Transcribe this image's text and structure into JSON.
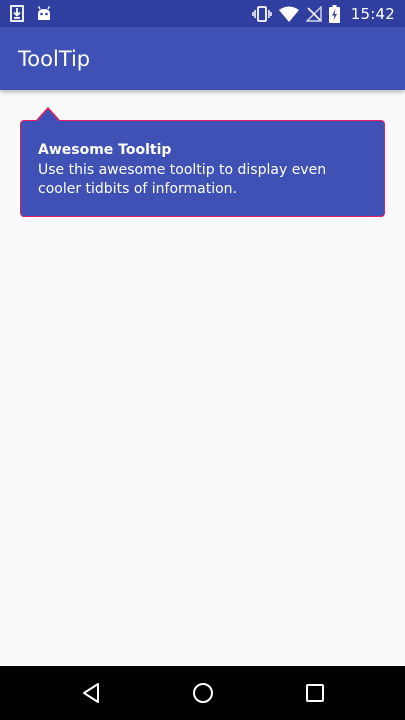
{
  "status_bar": {
    "time": "15:42",
    "left_icons": [
      "download-icon",
      "android-icon"
    ],
    "right_icons": [
      "vibrate-icon",
      "wifi-icon",
      "no-signal-icon",
      "battery-charging-icon"
    ]
  },
  "app_bar": {
    "title": "ToolTip"
  },
  "tooltip": {
    "title": "Awesome Tooltip",
    "body": "Use this awesome tooltip to display even cooler tidbits of information."
  },
  "nav_bar": {
    "buttons": [
      "back-icon",
      "home-icon",
      "recents-icon"
    ]
  },
  "colors": {
    "status_bar": "#303f9f",
    "primary": "#3f51b5",
    "tooltip_border": "#e91e63",
    "background": "#fafafa",
    "nav_bar": "#000000"
  }
}
